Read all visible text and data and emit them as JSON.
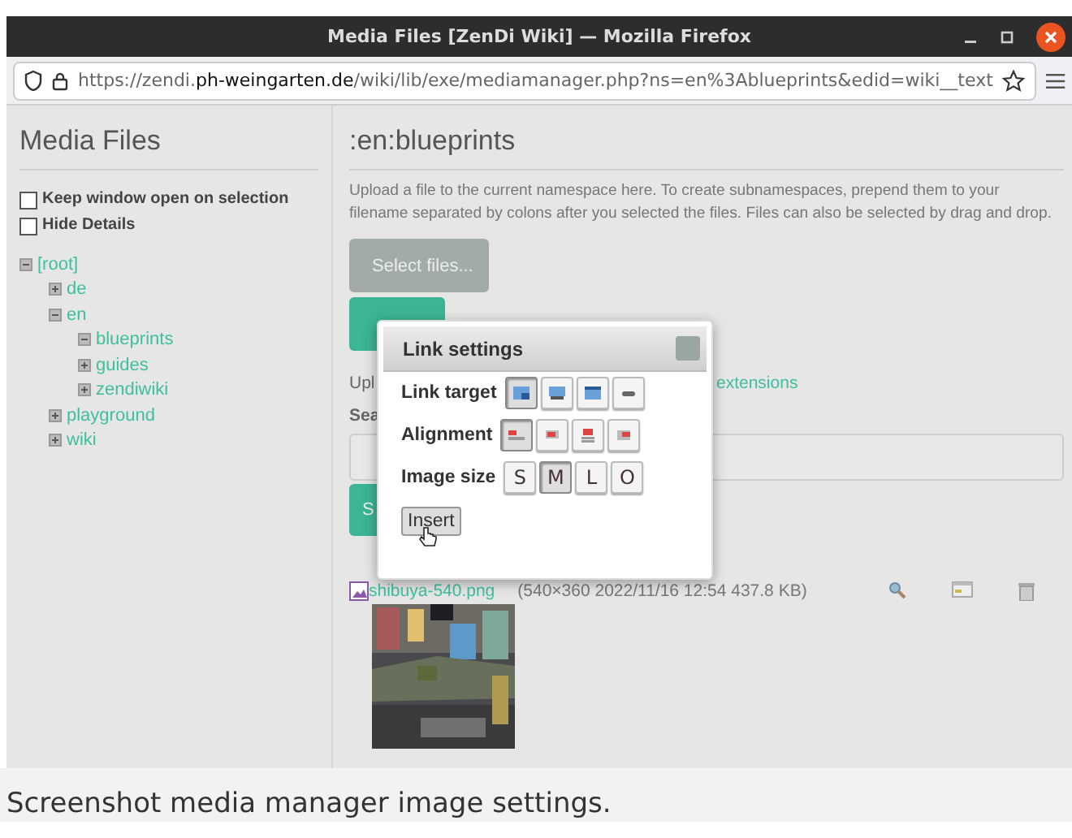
{
  "window": {
    "title": "Media Files [ZenDi Wiki] — Mozilla Firefox"
  },
  "address_bar": {
    "url_prefix": "https://zendi.",
    "url_domain": "ph-weingarten.de",
    "url_path": "/wiki/lib/exe/mediamanager.php?ns=en%3Ablueprints&edid=wiki__text"
  },
  "sidebar": {
    "title": "Media Files",
    "options": [
      {
        "label": "Keep window open on selection",
        "checked": false
      },
      {
        "label": "Hide Details",
        "checked": false
      }
    ],
    "tree": [
      {
        "label": "[root]",
        "expanded": true,
        "children": [
          {
            "label": "de",
            "expanded": false
          },
          {
            "label": "en",
            "expanded": true,
            "children": [
              {
                "label": "blueprints",
                "expanded": true
              },
              {
                "label": "guides",
                "expanded": false
              },
              {
                "label": "zendiwiki",
                "expanded": false
              }
            ]
          },
          {
            "label": "playground",
            "expanded": false
          },
          {
            "label": "wiki",
            "expanded": false
          }
        ]
      }
    ]
  },
  "main": {
    "namespace": ":en:blueprints",
    "upload_text": "Upload a file to the current namespace here. To create subnamespaces, prepend them to your filename separated by colons after you selected the files. Files can also be selected by drag and drop.",
    "select_button": "Select files...",
    "upload_hint": "Upl",
    "upload_hint_link": "extensions",
    "search_label": "Sea",
    "search_button": "S",
    "file": {
      "name": "shibuya-540.png",
      "details": "(540×360 2022/11/16 12:54 437.8 KB)"
    }
  },
  "dialog": {
    "title": "Link settings",
    "rows": [
      {
        "label": "Link target",
        "kind": "icons",
        "options": [
          {
            "selected": true
          },
          {
            "selected": false
          },
          {
            "selected": false
          },
          {
            "selected": false
          }
        ]
      },
      {
        "label": "Alignment",
        "kind": "align",
        "options": [
          {
            "selected": true
          },
          {
            "selected": false
          },
          {
            "selected": false
          },
          {
            "selected": false
          }
        ]
      },
      {
        "label": "Image size",
        "kind": "letters",
        "options": [
          {
            "label": "S",
            "selected": false
          },
          {
            "label": "M",
            "selected": true
          },
          {
            "label": "L",
            "selected": false
          },
          {
            "label": "O",
            "selected": false
          }
        ]
      }
    ],
    "insert_button": "Insert"
  },
  "caption": "Screenshot media manager image settings."
}
